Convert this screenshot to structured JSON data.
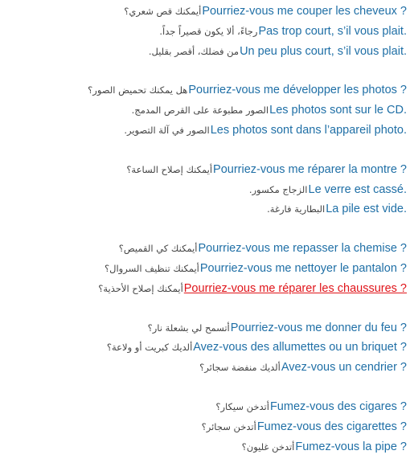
{
  "phrase_groups": [
    {
      "rows": [
        {
          "ar": "أيمكنك قص شعري؟",
          "fr": "Pourriez-vous me couper les cheveux ?"
        },
        {
          "ar": "رجاءً، ألا يكون قصيراً جداً.",
          "fr": "Pas trop court, s’il vous plait."
        },
        {
          "ar": "من فضلك، أقصر بقليل.",
          "fr": "Un peu plus court, s’il vous plait."
        }
      ]
    },
    {
      "rows": [
        {
          "ar": "هل يمكنك تحميض الصور؟",
          "fr": "Pourriez-vous me développer les photos ?"
        },
        {
          "ar": "الصور مطبوعة على القرص المدمج.",
          "fr": "Les photos sont sur le CD."
        },
        {
          "ar": "الصور في آلة التصوير.",
          "fr": "Les photos sont dans l’appareil photo."
        }
      ]
    },
    {
      "rows": [
        {
          "ar": "أيمكنك إصلاح الساعة؟",
          "fr": "Pourriez-vous me réparer la montre ?"
        },
        {
          "ar": "الزجاج مكسور.",
          "fr": "Le verre est cassé."
        },
        {
          "ar": "البطارية فارغة.",
          "fr": "La pile est vide."
        }
      ]
    },
    {
      "rows": [
        {
          "ar": "أيمكنك كي القميص؟",
          "fr": "Pourriez-vous me repasser la chemise ?"
        },
        {
          "ar": "أيمكنك تنظيف السروال؟",
          "fr": "Pourriez-vous me nettoyer le pantalon ?"
        },
        {
          "ar": "أيمكنك إصلاح الأحذية؟",
          "fr": "Pourriez-vous me réparer les chaussures ?",
          "active": true
        }
      ]
    },
    {
      "rows": [
        {
          "ar": "أتسمح لي بشعلة نار؟",
          "fr": "Pourriez-vous me donner du feu ?"
        },
        {
          "ar": "ألديك كبريت أو ولاعة؟",
          "fr": "Avez-vous des allumettes ou un briquet ?"
        },
        {
          "ar": "ألديك منفضة سجائر؟",
          "fr": "Avez-vous un cendrier ?"
        }
      ]
    },
    {
      "rows": [
        {
          "ar": "أتدخن سيكار؟",
          "fr": "Fumez-vous des cigares ?"
        },
        {
          "ar": "أتدخن سجائر؟",
          "fr": "Fumez-vous des cigarettes ?"
        },
        {
          "ar": "أتدخن غليون؟",
          "fr": "Fumez-vous la pipe ?"
        }
      ]
    }
  ],
  "colors": {
    "link": "#1f6fa6",
    "active_link": "#e0141a",
    "arabic_text": "#444444",
    "background": "#ffffff"
  }
}
